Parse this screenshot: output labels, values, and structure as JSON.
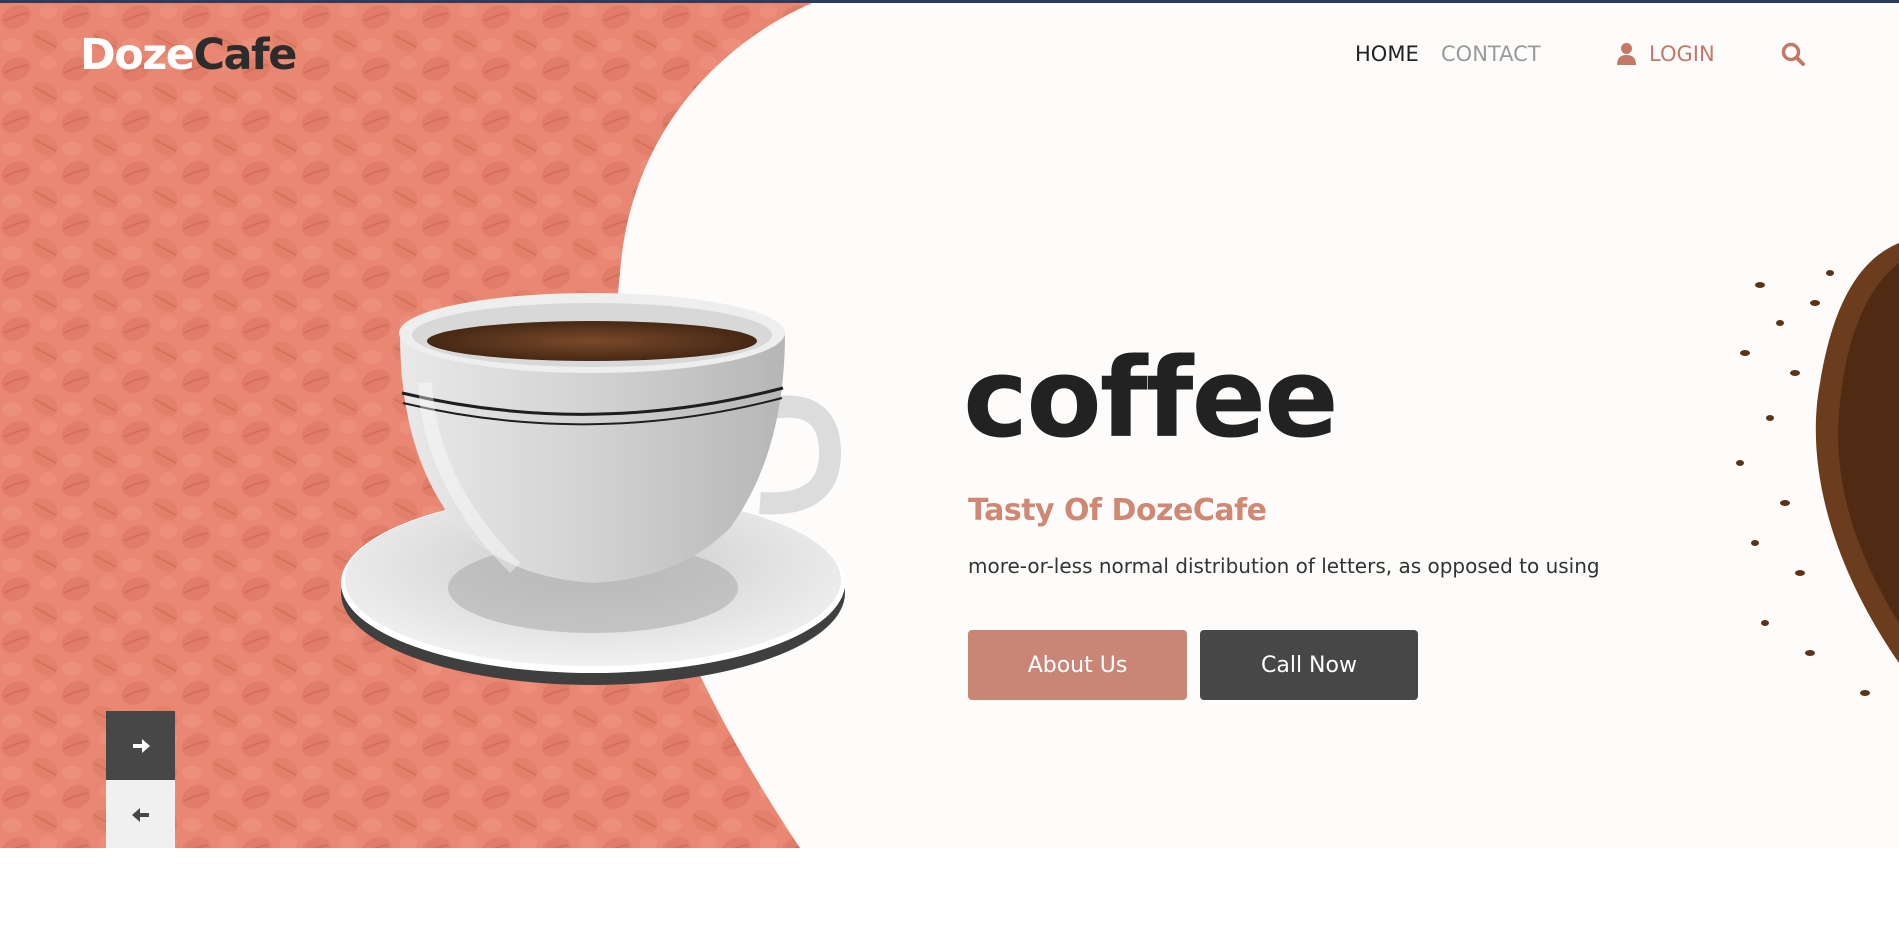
{
  "brand": {
    "part1": "Doze",
    "part2": "Cafe"
  },
  "nav": {
    "home": "HOME",
    "contact": "CONTACT",
    "login": "LOGIN",
    "login_icon": "user-icon",
    "search_icon": "search-icon"
  },
  "hero": {
    "title": "coffee",
    "subtitle": "Tasty Of DozeCafe",
    "description": "more-or-less normal distribution of letters, as opposed to using",
    "about_button": "About Us",
    "call_button": "Call Now"
  },
  "slider": {
    "next_icon": "arrow-right-icon",
    "prev_icon": "arrow-left-icon"
  },
  "colors": {
    "accent": "#c98676",
    "accent_text": "#d08773",
    "dark": "#474747",
    "bean_panel": "#e3836f",
    "background": "#fdfcfa"
  }
}
